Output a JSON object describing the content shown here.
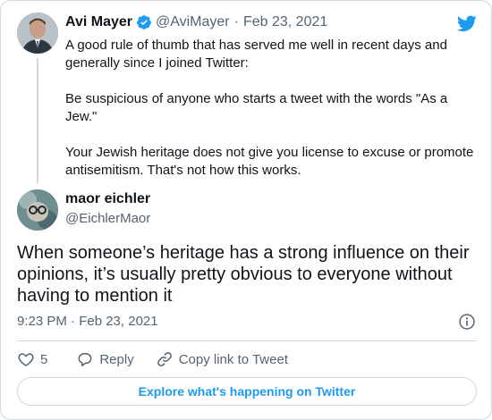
{
  "quoted_tweet": {
    "author_name": "Avi Mayer",
    "handle": "@AviMayer",
    "separator": "·",
    "date": "Feb 23, 2021",
    "paragraphs": [
      "A good rule of thumb that has served me well in recent days and generally since I joined Twitter:",
      "Be suspicious of anyone who starts a tweet with the words \"As a Jew.\"",
      "Your Jewish heritage does not give you license to excuse or promote antisemitism. That's not how this works."
    ]
  },
  "reply_tweet": {
    "author_name": "maor eichler",
    "handle": "@EichlerMaor",
    "text": "When someone’s heritage has a strong influence on their opinions, it’s usually pretty obvious to everyone without having to mention it",
    "timestamp": "9:23 PM · Feb 23, 2021"
  },
  "actions": {
    "like_count": "5",
    "reply_label": "Reply",
    "copy_link_label": "Copy link to Tweet"
  },
  "explore_label": "Explore what's happening on Twitter",
  "colors": {
    "accent": "#1d9bf0",
    "text": "#0f1419",
    "muted": "#536471",
    "border": "#cfd9de"
  },
  "icons": [
    "verified-badge-icon",
    "twitter-bird-icon",
    "info-icon",
    "heart-icon",
    "reply-icon",
    "link-icon"
  ]
}
